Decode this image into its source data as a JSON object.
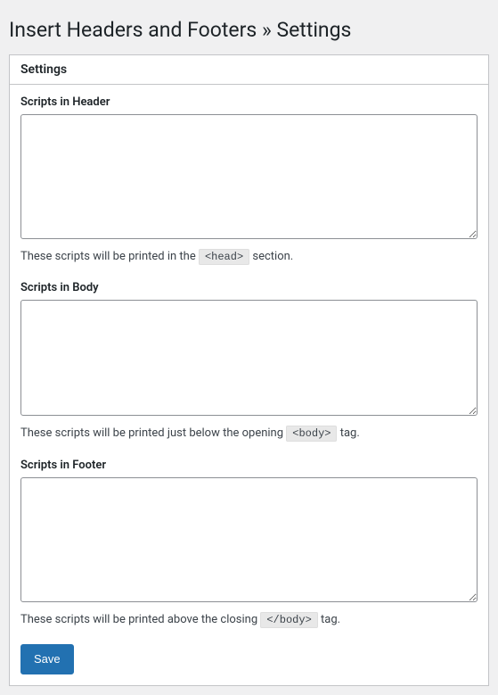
{
  "page": {
    "title": "Insert Headers and Footers » Settings"
  },
  "panel": {
    "heading": "Settings"
  },
  "fields": {
    "header": {
      "label": "Scripts in Header",
      "value": "",
      "description_pre": "These scripts will be printed in the ",
      "description_code": "<head>",
      "description_post": " section."
    },
    "body": {
      "label": "Scripts in Body",
      "value": "",
      "description_pre": "These scripts will be printed just below the opening ",
      "description_code": "<body>",
      "description_post": " tag."
    },
    "footer": {
      "label": "Scripts in Footer",
      "value": "",
      "description_pre": "These scripts will be printed above the closing ",
      "description_code": "</body>",
      "description_post": " tag."
    }
  },
  "actions": {
    "save": "Save"
  }
}
